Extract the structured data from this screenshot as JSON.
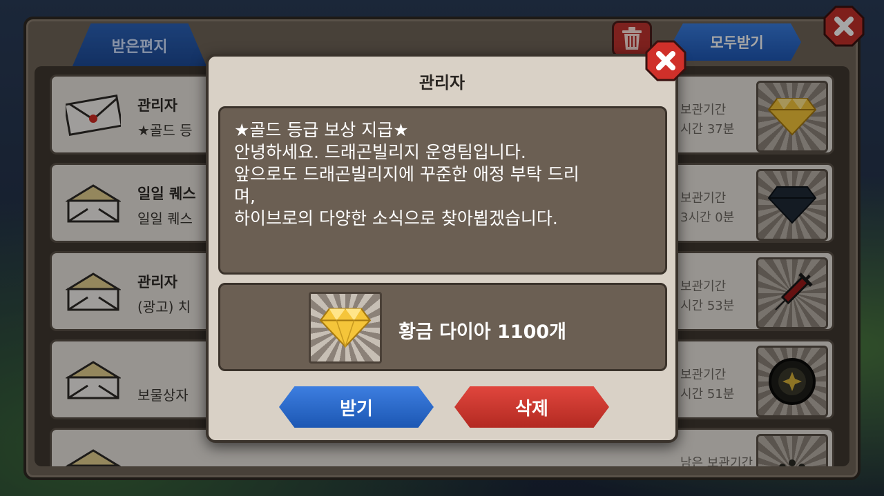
{
  "mailbox": {
    "tab_received": "받은편지",
    "receive_all": "모두받기",
    "items": [
      {
        "sender": "관리자",
        "subject": "★골드 등",
        "keep_label": "보관기간",
        "keep_time": "시간 37분",
        "reward_icon": "gold-diamond-icon",
        "envelope": "sealed"
      },
      {
        "sender": "일일 퀘스",
        "subject": "일일 퀘스",
        "keep_label": "보관기간",
        "keep_time": "3시간 0분",
        "reward_icon": "dark-diamond-icon",
        "envelope": "open"
      },
      {
        "sender": "관리자",
        "subject": "(광고) 치",
        "keep_label": "보관기간",
        "keep_time": "시간 53분",
        "reward_icon": "syringe-icon",
        "envelope": "open"
      },
      {
        "sender": "",
        "subject": "보물상자",
        "keep_label": "보관기간",
        "keep_time": "시간 51분",
        "reward_icon": "treasure-emblem-icon",
        "envelope": "open"
      },
      {
        "sender": "",
        "subject": "",
        "keep_label": "남은 보관기간",
        "keep_time": "",
        "reward_icon": "paw-icon",
        "envelope": "open"
      }
    ]
  },
  "modal": {
    "title": "관리자",
    "message_lines": [
      "★골드 등급 보상 지급★",
      "안녕하세요. 드래곤빌리지 운영팀입니다.",
      "앞으로도 드래곤빌리지에 꾸준한 애정 부탁 드리",
      "며,",
      "하이브로의 다양한 소식으로 찾아뵙겠습니다."
    ],
    "reward_name": "황금 다이아 1100개",
    "reward_icon": "gold-diamond-icon",
    "receive_label": "받기",
    "delete_label": "삭제"
  },
  "colors": {
    "panel": "#6f6458",
    "modal": "#d9d1c6",
    "blue_button": "#2a68c8",
    "red_button": "#c93128",
    "gold_diamond": "#f5c53a"
  }
}
